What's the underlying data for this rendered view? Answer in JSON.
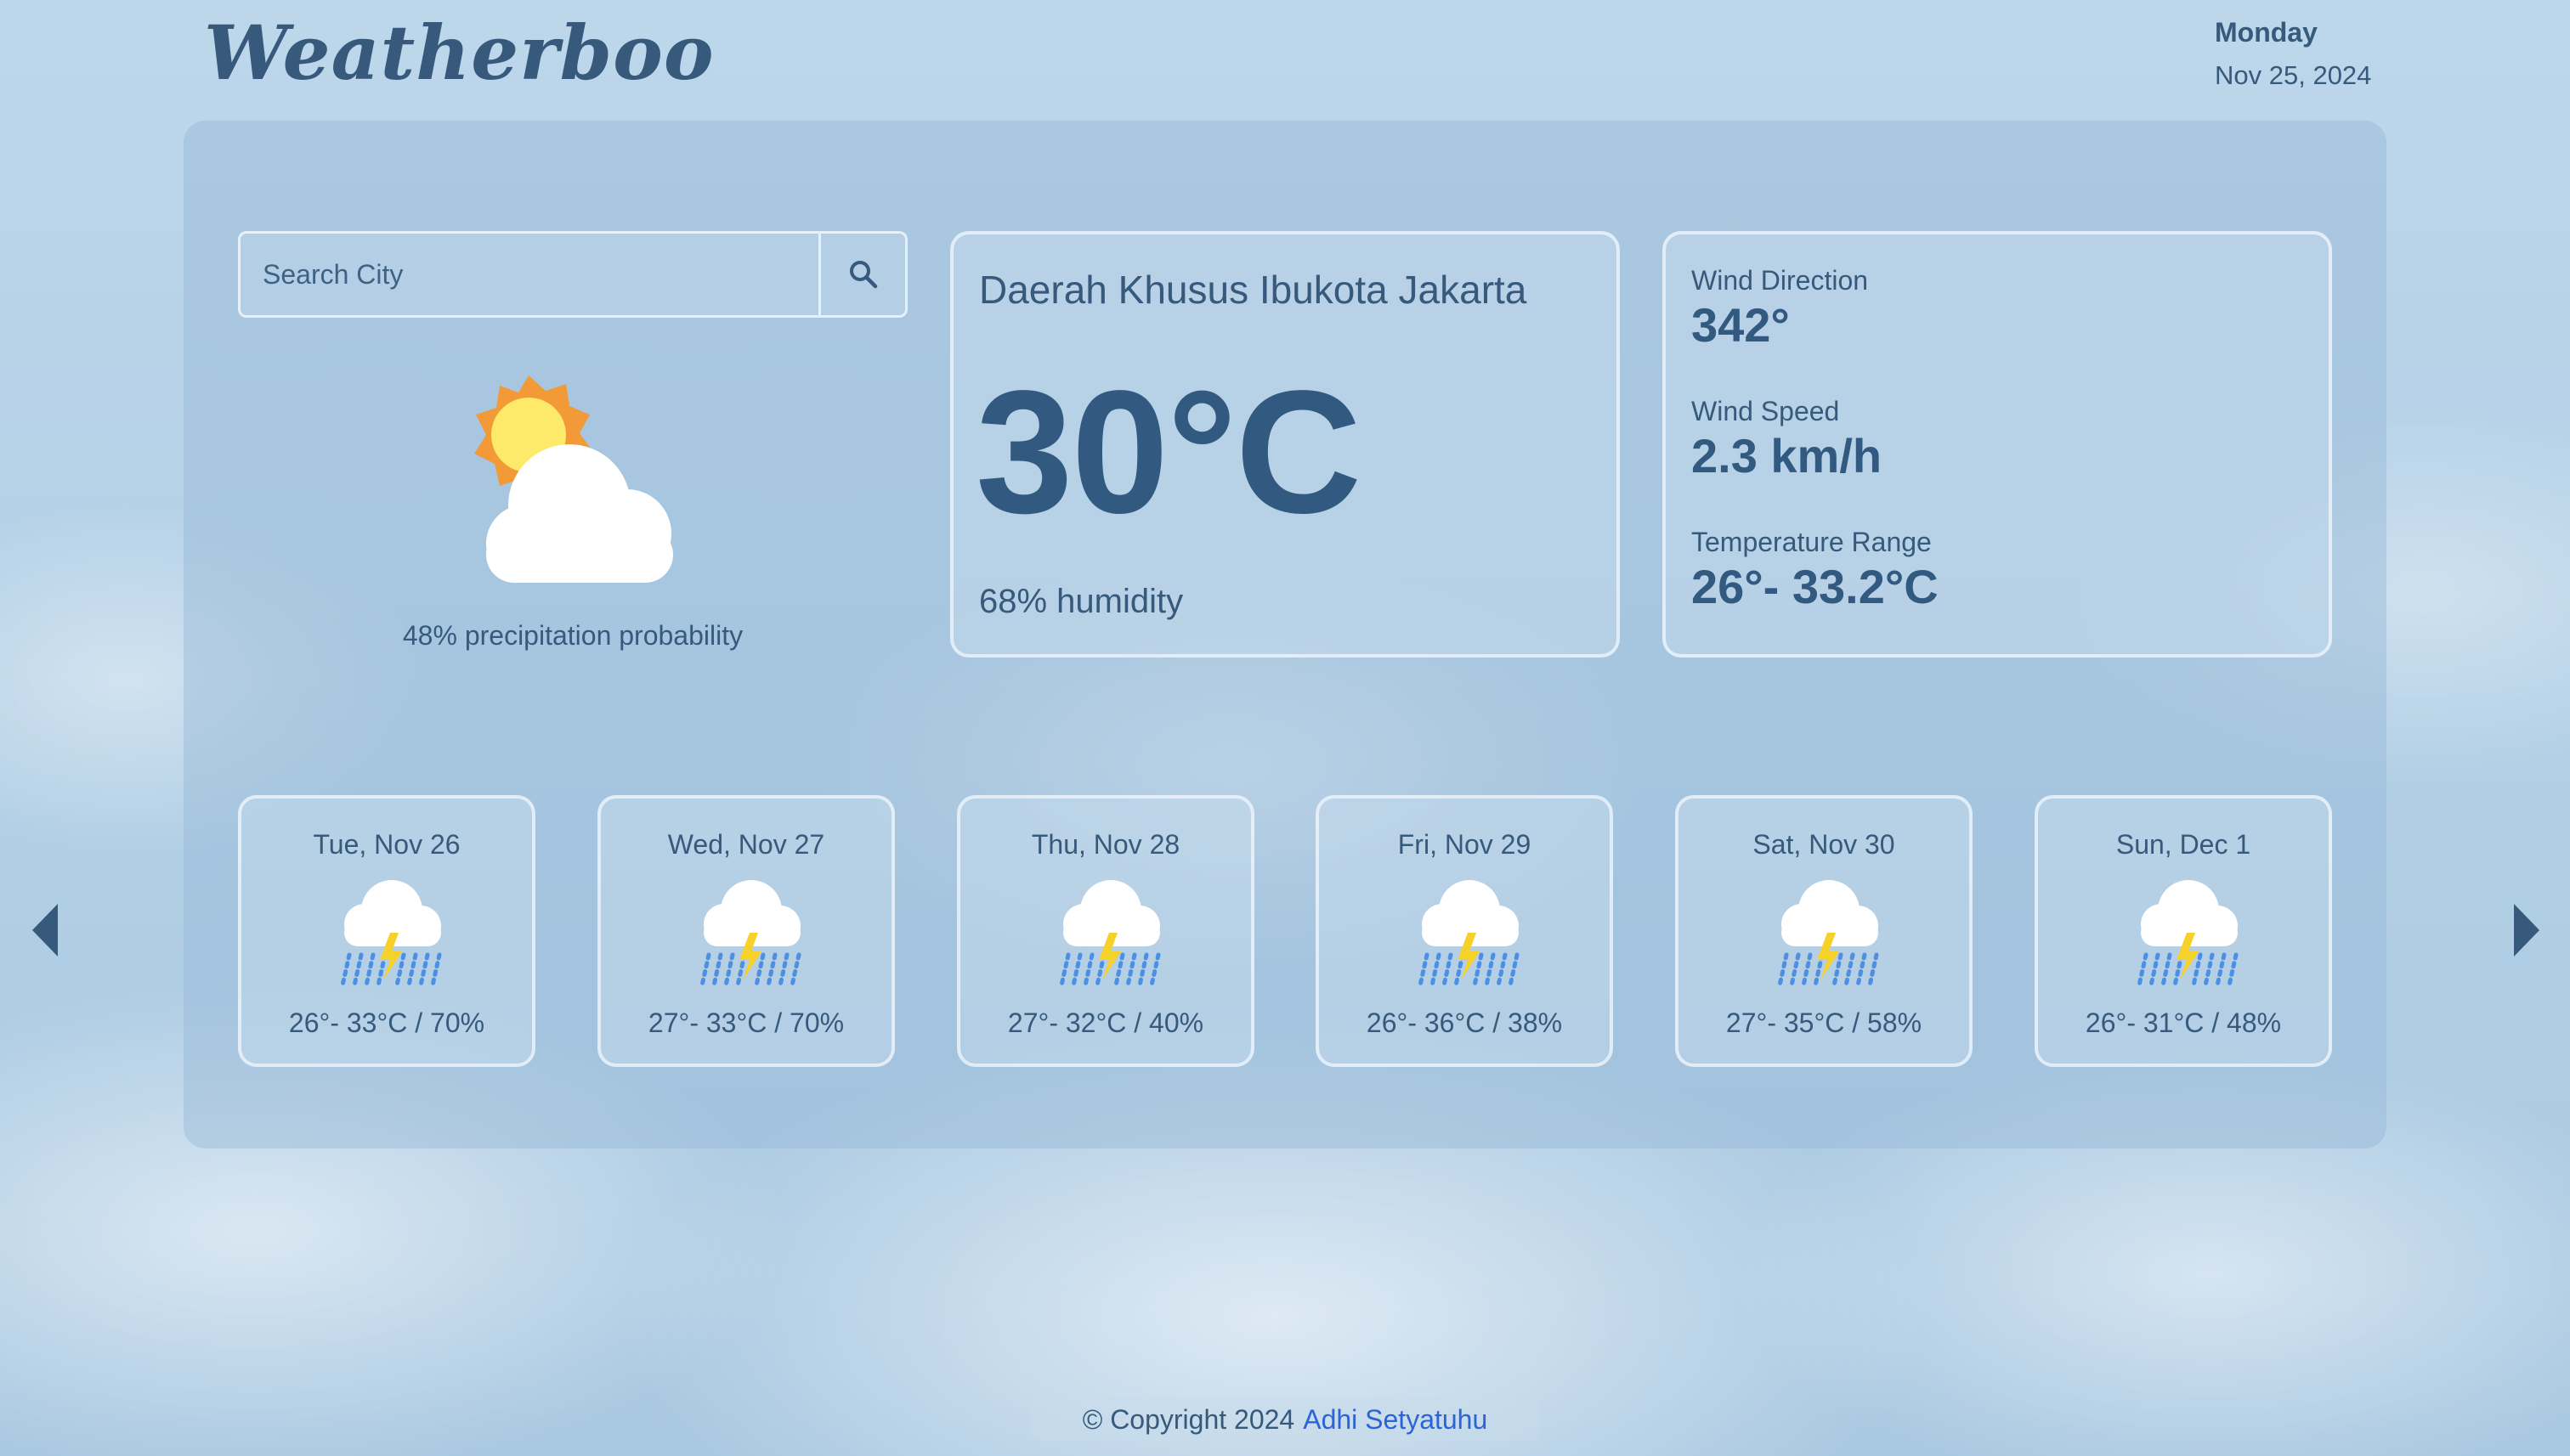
{
  "header": {
    "brand": "Weatherboo",
    "day": "Monday",
    "date": "Nov 25, 2024"
  },
  "search": {
    "placeholder": "Search City",
    "icon": "search-icon"
  },
  "current": {
    "icon": "partly-cloudy-icon",
    "precipitation": "48% precipitation probability",
    "city": "Daerah Khusus Ibukota Jakarta",
    "temperature": "30°C",
    "humidity": "68% humidity"
  },
  "details": {
    "wind_direction_label": "Wind Direction",
    "wind_direction_value": "342°",
    "wind_speed_label": "Wind Speed",
    "wind_speed_value": "2.3 km/h",
    "temp_range_label": "Temperature Range",
    "temp_range_value": "26°- 33.2°C"
  },
  "forecast": [
    {
      "date": "Tue, Nov 26",
      "icon": "thunderstorm-rain-icon",
      "range": "26°- 33°C / 70%"
    },
    {
      "date": "Wed, Nov 27",
      "icon": "thunderstorm-rain-icon",
      "range": "27°- 33°C / 70%"
    },
    {
      "date": "Thu, Nov 28",
      "icon": "thunderstorm-rain-icon",
      "range": "27°- 32°C / 40%"
    },
    {
      "date": "Fri, Nov 29",
      "icon": "thunderstorm-rain-icon",
      "range": "26°- 36°C / 38%"
    },
    {
      "date": "Sat, Nov 30",
      "icon": "thunderstorm-rain-icon",
      "range": "27°- 35°C / 58%"
    },
    {
      "date": "Sun, Dec 1",
      "icon": "thunderstorm-rain-icon",
      "range": "26°- 31°C / 48%"
    }
  ],
  "nav": {
    "prev_icon": "chevron-left-icon",
    "next_icon": "chevron-right-icon"
  },
  "footer": {
    "copyright": "© Copyright 2024",
    "author": "Adhi Setyatuhu"
  },
  "colors": {
    "text": "#36597c",
    "accent": "#325a80",
    "link": "#2b64d6",
    "sun_outer": "#f29a38",
    "sun_inner": "#fde96a",
    "rain": "#4d8fe3",
    "bolt": "#f6d12a"
  }
}
